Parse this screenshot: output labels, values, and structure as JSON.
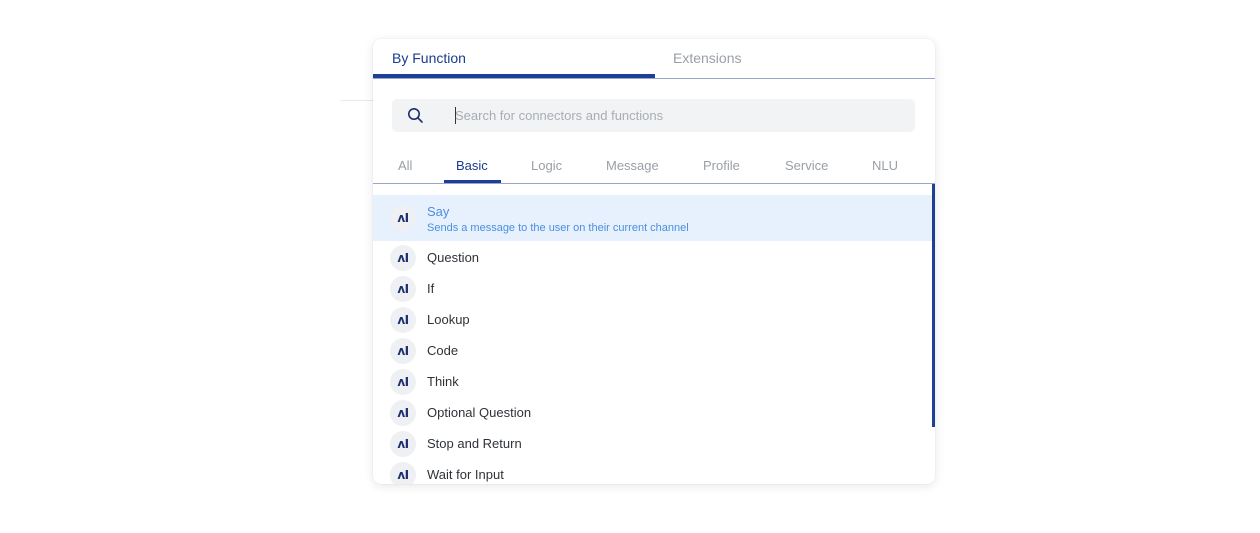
{
  "top_tabs": [
    {
      "label": "By Function",
      "active": true
    },
    {
      "label": "Extensions",
      "active": false
    }
  ],
  "search": {
    "placeholder": "Search for connectors and functions",
    "value": "",
    "icon": "search-icon"
  },
  "category_tabs": [
    {
      "label": "All",
      "active": false
    },
    {
      "label": "Basic",
      "active": true
    },
    {
      "label": "Logic",
      "active": false
    },
    {
      "label": "Message",
      "active": false
    },
    {
      "label": "Profile",
      "active": false
    },
    {
      "label": "Service",
      "active": false
    },
    {
      "label": "NLU",
      "active": false
    }
  ],
  "functions": [
    {
      "icon": "ʌI",
      "name": "Say",
      "description": "Sends a message to the user on their current channel",
      "selected": true
    },
    {
      "icon": "ʌI",
      "name": "Question"
    },
    {
      "icon": "ʌI",
      "name": "If"
    },
    {
      "icon": "ʌI",
      "name": "Lookup"
    },
    {
      "icon": "ʌI",
      "name": "Code"
    },
    {
      "icon": "ʌI",
      "name": "Think"
    },
    {
      "icon": "ʌI",
      "name": "Optional Question"
    },
    {
      "icon": "ʌI",
      "name": "Stop and Return"
    },
    {
      "icon": "ʌI",
      "name": "Wait for Input"
    }
  ],
  "colors": {
    "accent": "#1e3f96",
    "selected_bg": "#e7f1fd",
    "selected_text": "#4a8ee0",
    "search_bg": "#f2f3f5"
  }
}
